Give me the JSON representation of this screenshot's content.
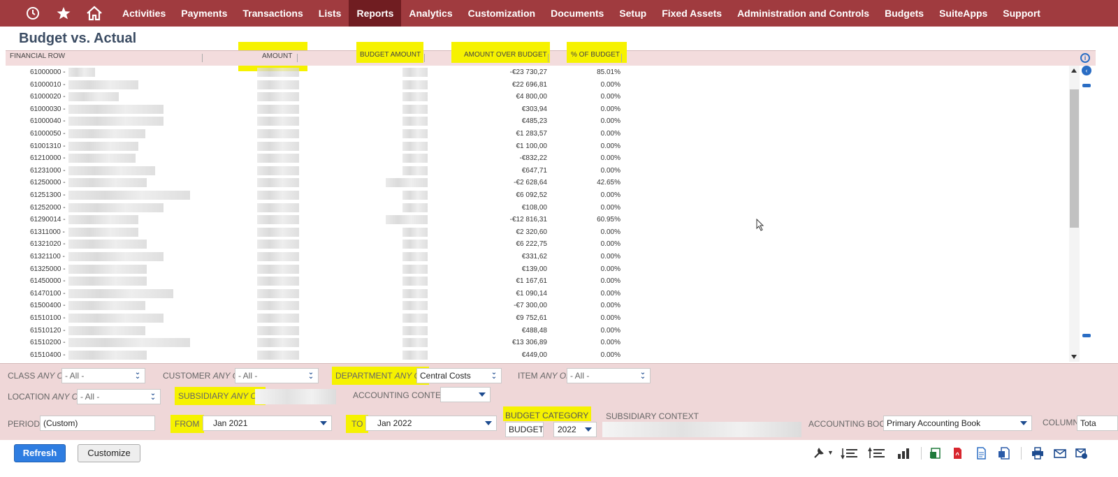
{
  "nav": {
    "icons": [
      "recent-records-icon",
      "star-icon",
      "home-icon"
    ],
    "items": [
      {
        "label": "Activities"
      },
      {
        "label": "Payments"
      },
      {
        "label": "Transactions"
      },
      {
        "label": "Lists"
      },
      {
        "label": "Reports",
        "active": true
      },
      {
        "label": "Analytics"
      },
      {
        "label": "Customization"
      },
      {
        "label": "Documents"
      },
      {
        "label": "Setup"
      },
      {
        "label": "Fixed Assets"
      },
      {
        "label": "Administration and Controls"
      },
      {
        "label": "Budgets"
      },
      {
        "label": "SuiteApps"
      },
      {
        "label": "Support"
      }
    ],
    "bg_color": "#a03b3f",
    "active_color": "#701d21"
  },
  "page": {
    "title": "Budget vs. Actual"
  },
  "table": {
    "headers": {
      "financial_row": "FINANCIAL ROW",
      "amount": "AMOUNT",
      "budget_amount": "BUDGET AMOUNT",
      "amount_over_budget": "AMOUNT OVER BUDGET",
      "pct_of_budget": "% OF BUDGET"
    },
    "rows": [
      {
        "account": "61000000 -",
        "over": "-€23 730,27",
        "pct": "85.01%"
      },
      {
        "account": "61000010 -",
        "over": "€22 696,81",
        "pct": "0.00%"
      },
      {
        "account": "61000020 -",
        "over": "€4 800,00",
        "pct": "0.00%"
      },
      {
        "account": "61000030 -",
        "over": "€303,94",
        "pct": "0.00%"
      },
      {
        "account": "61000040 -",
        "over": "€485,23",
        "pct": "0.00%"
      },
      {
        "account": "61000050 -",
        "over": "€1 283,57",
        "pct": "0.00%"
      },
      {
        "account": "61001310 -",
        "over": "€1 100,00",
        "pct": "0.00%"
      },
      {
        "account": "61210000 -",
        "over": "-€832,22",
        "pct": "0.00%"
      },
      {
        "account": "61231000 -",
        "over": "€647,71",
        "pct": "0.00%"
      },
      {
        "account": "61250000 -",
        "over": "-€2 628,64",
        "pct": "42.65%"
      },
      {
        "account": "61251300 -",
        "over": "€6 092,52",
        "pct": "0.00%"
      },
      {
        "account": "61252000 -",
        "over": "€108,00",
        "pct": "0.00%"
      },
      {
        "account": "61290014 -",
        "over": "-€12 816,31",
        "pct": "60.95%"
      },
      {
        "account": "61311000 -",
        "over": "€2 320,60",
        "pct": "0.00%"
      },
      {
        "account": "61321020 -",
        "over": "€6 222,75",
        "pct": "0.00%"
      },
      {
        "account": "61321100 -",
        "over": "€331,62",
        "pct": "0.00%"
      },
      {
        "account": "61325000 -",
        "over": "€139,00",
        "pct": "0.00%"
      },
      {
        "account": "61450000 -",
        "over": "€1 167,61",
        "pct": "0.00%"
      },
      {
        "account": "61470100 -",
        "over": "€1 090,14",
        "pct": "0.00%"
      },
      {
        "account": "61500400 -",
        "over": "-€7 300,00",
        "pct": "0.00%"
      },
      {
        "account": "61510100 -",
        "over": "€9 752,61",
        "pct": "0.00%"
      },
      {
        "account": "61510120 -",
        "over": "€488,48",
        "pct": "0.00%"
      },
      {
        "account": "61510200 -",
        "over": "€13 306,89",
        "pct": "0.00%"
      },
      {
        "account": "61510400 -",
        "over": "€449,00",
        "pct": "0.00%"
      }
    ]
  },
  "filters": {
    "class": {
      "label": "CLASS",
      "qual": "ANY OF",
      "value": "- All -"
    },
    "customer": {
      "label": "CUSTOMER",
      "qual": "ANY OF",
      "value": "- All -"
    },
    "department": {
      "label": "DEPARTMENT",
      "qual": "ANY OF",
      "value": "Central Costs"
    },
    "item": {
      "label": "ITEM",
      "qual": "ANY OF",
      "value": "- All -"
    },
    "location": {
      "label": "LOCATION",
      "qual": "ANY OF",
      "value": "- All -"
    },
    "subsidiary": {
      "label": "SUBSIDIARY",
      "qual": "ANY OF"
    },
    "accounting_context": {
      "label": "ACCOUNTING CONTEXT",
      "value": ""
    },
    "period": {
      "label": "PERIOD",
      "value": "(Custom)"
    },
    "from": {
      "label": "FROM",
      "value": "Jan 2021"
    },
    "to": {
      "label": "TO",
      "value": "Jan 2022"
    },
    "budget_category": {
      "label": "BUDGET CATEGORY",
      "value": "BUDGET",
      "year": "2022"
    },
    "subsidiary_context": {
      "label": "SUBSIDIARY CONTEXT"
    },
    "accounting_book": {
      "label": "ACCOUNTING BOOK",
      "value": "Primary Accounting Book"
    },
    "column": {
      "label": "COLUMN",
      "value": "Tota"
    }
  },
  "buttons": {
    "refresh": "Refresh",
    "customize": "Customize"
  },
  "toolbar": [
    "wrench-icon",
    "collapse-rows-icon",
    "expand-rows-icon",
    "chart-icon",
    "excel-icon",
    "pdf-icon",
    "document-icon",
    "word-icon",
    "print-icon",
    "email-icon",
    "schedule-icon"
  ],
  "highlight_color": "#f6f200"
}
